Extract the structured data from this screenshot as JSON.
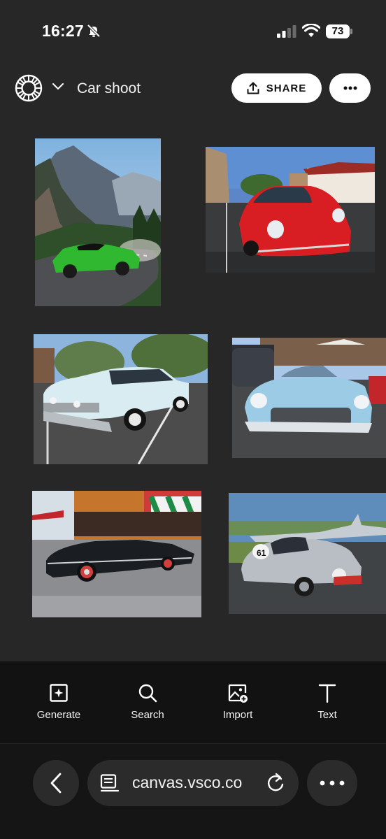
{
  "status_bar": {
    "time": "16:27",
    "battery": "73",
    "icons": [
      "bell-off-icon",
      "signal-icon",
      "wifi-icon",
      "battery-icon"
    ]
  },
  "header": {
    "logo_icon": "vsco-logo-icon",
    "dropdown_icon": "chevron-down-icon",
    "title": "Car shoot",
    "share_label": "SHARE",
    "share_icon": "upload-icon",
    "more_icon": "more-horizontal-icon"
  },
  "canvas": {
    "photos": [
      {
        "subject": "green sports car on mountain road",
        "main_color": "#2fb830"
      },
      {
        "subject": "red vintage coupe on street",
        "main_color": "#d81e22"
      },
      {
        "subject": "light blue classic sedan",
        "main_color": "#d9ecf2"
      },
      {
        "subject": "light blue classic convertible",
        "main_color": "#9ccbe6"
      },
      {
        "subject": "black classic convertible",
        "main_color": "#1a1d22"
      },
      {
        "subject": "silver rally car number 61",
        "main_color": "#b9bec4",
        "race_number": "61"
      }
    ]
  },
  "toolbar": {
    "items": [
      {
        "label": "Generate",
        "icon": "generate-plus-icon"
      },
      {
        "label": "Search",
        "icon": "search-icon"
      },
      {
        "label": "Import",
        "icon": "import-image-icon"
      },
      {
        "label": "Text",
        "icon": "text-icon"
      }
    ]
  },
  "browser": {
    "url": "canvas.vsco.co",
    "back_icon": "chevron-left-icon",
    "page_icon": "page-menu-icon",
    "reload_icon": "reload-icon",
    "more_icon": "more-horizontal-icon"
  },
  "colors": {
    "background": "#272727",
    "toolbar": "#121212",
    "browser_bar": "#151515",
    "pill": "#2b2b2b",
    "button": "#ffffff"
  }
}
